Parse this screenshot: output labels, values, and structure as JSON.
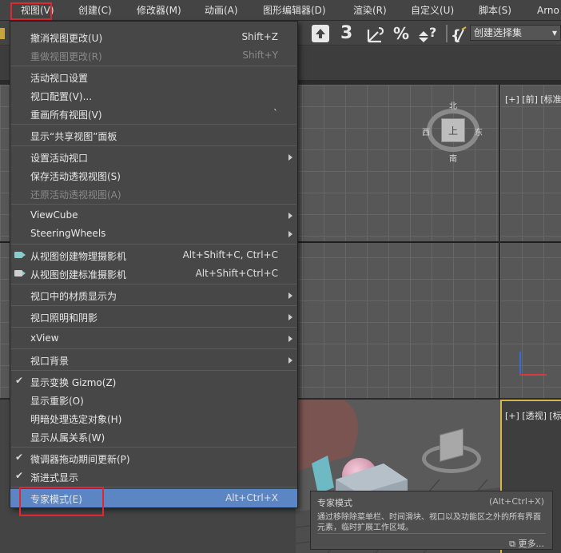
{
  "menubar": {
    "items": [
      "视图(V)",
      "创建(C)",
      "修改器(M)",
      "动画(A)",
      "图形编辑器(D)",
      "渲染(R)",
      "自定义(U)",
      "脚本(S)",
      "Arno"
    ]
  },
  "toolbar": {
    "selection_set": "创建选择集"
  },
  "viewports": {
    "front_label": "[+] [前] [标准",
    "persp_label": "[+] [透视] [标"
  },
  "viewcube": {
    "north": "北",
    "south": "南",
    "west": "西",
    "east": "东",
    "face": "上"
  },
  "menu": {
    "items": [
      {
        "label": "撤消视图更改(U)",
        "shortcut": "Shift+Z"
      },
      {
        "label": "重做视图更改(R)",
        "shortcut": "Shift+Y",
        "disabled": true
      },
      {
        "label": "活动视口设置"
      },
      {
        "label": "视口配置(V)..."
      },
      {
        "label": "重画所有视图(V)",
        "shortcut": "`"
      },
      {
        "label": "显示“共享视图”面板"
      },
      {
        "label": "设置活动视口"
      },
      {
        "label": "保存活动透视视图(S)"
      },
      {
        "label": "还原活动透视视图(A)",
        "disabled": true
      },
      {
        "label": "ViewCube"
      },
      {
        "label": "SteeringWheels"
      },
      {
        "label": "从视图创建物理摄影机",
        "shortcut": "Alt+Shift+C, Ctrl+C"
      },
      {
        "label": "从视图创建标准摄影机",
        "shortcut": "Alt+Shift+Ctrl+C"
      },
      {
        "label": "视口中的材质显示为"
      },
      {
        "label": "视口照明和阴影"
      },
      {
        "label": "xView"
      },
      {
        "label": "视口背景"
      },
      {
        "label": "显示变换 Gizmo(Z)"
      },
      {
        "label": "显示重影(O)"
      },
      {
        "label": "明暗处理选定对象(H)"
      },
      {
        "label": "显示从属关系(W)"
      },
      {
        "label": "微调器拖动期间更新(P)"
      },
      {
        "label": "渐进式显示"
      },
      {
        "label": "专家模式(E)",
        "shortcut": "Alt+Ctrl+X"
      }
    ]
  },
  "tooltip": {
    "title": "专家模式",
    "shortcut": "(Alt+Ctrl+X)",
    "description": "通过移除除菜单栏、时间滑块、视口以及功能区之外的所有界面元素，临时扩展工作区域。",
    "more": "更多..."
  }
}
